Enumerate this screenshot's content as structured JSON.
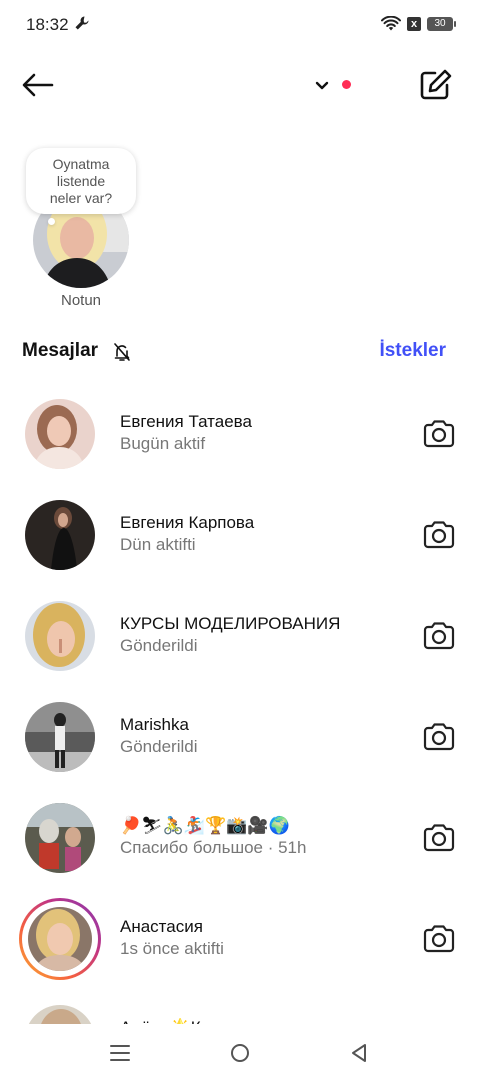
{
  "status_bar": {
    "time": "18:32",
    "battery": "30",
    "x_badge": "x",
    "icons": [
      "wrench-icon",
      "wifi-icon",
      "x-box-icon",
      "battery-icon"
    ]
  },
  "header": {
    "icons": [
      "back-arrow-icon",
      "chevron-down-icon",
      "compose-icon"
    ],
    "notification_dot_color": "#ff2d55"
  },
  "note": {
    "bubble_lines": [
      "Oynatma",
      "listende",
      "neler var?"
    ],
    "label": "Notun"
  },
  "messages_section": {
    "title": "Mesajlar",
    "requests_label": "İstekler",
    "accent_color": "#4150f7"
  },
  "threads": [
    {
      "name": "Евгения Татаева",
      "subtitle": "Bugün aktif",
      "story_ring": false
    },
    {
      "name": "Евгения Карпова",
      "subtitle": "Dün aktifti",
      "story_ring": false
    },
    {
      "name": "КУРСЫ МОДЕЛИРОВАНИЯ",
      "subtitle": "Gönderildi",
      "story_ring": false
    },
    {
      "name": "Marishka",
      "subtitle": "Gönderildi",
      "story_ring": false
    },
    {
      "name": "🏓⛷🚴🏂🏆📸🎥🌍",
      "subtitle": "Спасибо большое · 51h",
      "story_ring": false
    },
    {
      "name": "Анастасия",
      "subtitle": "1s önce aktifti",
      "story_ring": true
    },
    {
      "name": "Алёна🌟Квантовая ведьма",
      "subtitle": "",
      "story_ring": false
    }
  ],
  "nav_bar": {
    "icons": [
      "menu-icon",
      "home-circle-icon",
      "back-triangle-icon"
    ]
  }
}
